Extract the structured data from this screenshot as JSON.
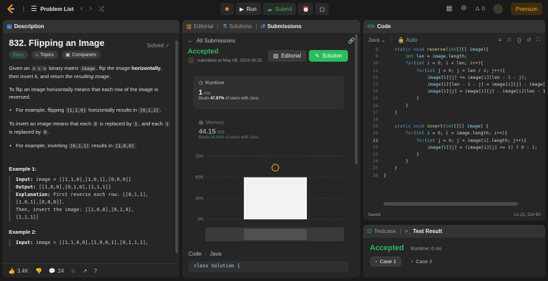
{
  "topbar": {
    "problem_list": "Problem List",
    "run": "Run",
    "submit": "Submit",
    "streak": "0",
    "premium": "Premium"
  },
  "description": {
    "tab_label": "Description",
    "title": "832. Flipping an Image",
    "solved": "Solved",
    "chips": [
      "Easy",
      "Topics",
      "Companies"
    ],
    "intro_1": "Given an",
    "intro_code_1": "n x n",
    "intro_2": "binary matrix",
    "intro_code_2": "image",
    "intro_3": ", flip the image",
    "intro_bold": "horizontally",
    "intro_4": ", then invert it, and return",
    "intro_italic": "the resulting image",
    "intro_5": ".",
    "flip_text": "To flip an image horizontally means that each row of the image is reversed.",
    "flip_bullet_1": "For example, flipping",
    "flip_bullet_code_1": "[1,1,0]",
    "flip_bullet_2": "horizontally results in",
    "flip_bullet_code_2": "[0,1,1]",
    "flip_bullet_3": ".",
    "invert_1": "To invert an image means that each",
    "invert_code_1": "0",
    "invert_2": "is replaced by",
    "invert_code_2": "1",
    "invert_3": ", and each",
    "invert_code_3": "1",
    "invert_4": "is replaced by",
    "invert_code_4": "0",
    "invert_5": ".",
    "invert_bullet_1": "For example, inverting",
    "invert_bullet_code_1": "[0,1,1]",
    "invert_bullet_2": "results in",
    "invert_bullet_code_2": "[1,0,0]",
    "invert_bullet_3": ".",
    "example1_title": "Example 1:",
    "example1_input_lbl": "Input:",
    "example1_input": " image = [[1,1,0],[1,0,1],[0,0,0]]",
    "example1_output_lbl": "Output:",
    "example1_output": " [[1,0,0],[0,1,0],[1,1,1]]",
    "example1_expl_lbl": "Explanation:",
    "example1_expl_1": " First reverse each row: [[0,1,1],",
    "example1_expl_2": "[1,0,1],[0,0,0]].",
    "example1_expl_3": "Then, invert the image: [[1,0,0],[0,1,0],",
    "example1_expl_4": "[1,1,1]]",
    "example2_title": "Example 2:",
    "example2_input_lbl": "Input:",
    "example2_input": " image = [[1,1,0,0],[1,0,0,1],[0,1,1,1],",
    "likes": "3.4K",
    "comments": "24"
  },
  "submissions": {
    "tabs": [
      "Editorial",
      "Solutions",
      "Submissions"
    ],
    "back_label": "All Submissions",
    "status": "Accepted",
    "submitted": "submitted at May 06, 2024 08:31",
    "editorial_btn": "Editorial",
    "solution_btn": "Solution",
    "runtime_label": "Runtime",
    "runtime_value": "1",
    "runtime_unit": "ms",
    "runtime_beats_1": "Beats",
    "runtime_beats_pct": "47.87%",
    "runtime_beats_2": "of users with Java",
    "memory_label": "Memory",
    "memory_value": "44.15",
    "memory_unit": "MB",
    "memory_beats_1": "Beats",
    "memory_beats_pct": "39.84%",
    "memory_beats_2": "of users with Java",
    "code_label": "Code",
    "code_lang": "Java",
    "code_preview": "class Solution {"
  },
  "chart_data": {
    "type": "bar",
    "ytick_labels": [
      "75%",
      "50%",
      "25%",
      "0%"
    ],
    "ylim": [
      0,
      75
    ],
    "values": [
      50
    ],
    "grid": true
  },
  "editor": {
    "tab_label": "Code",
    "lang": "Java",
    "auto": "Auto",
    "lines": [
      {
        "n": "8",
        "indent": 1,
        "tokens": [
          [
            "kw",
            "static "
          ],
          [
            "kw",
            "void "
          ],
          [
            "fn",
            "reverse"
          ],
          [
            "",
            "("
          ],
          [
            "ty",
            "int"
          ],
          [
            "",
            "[][] "
          ],
          [
            "va",
            "image"
          ],
          [
            "",
            "){"
          ]
        ]
      },
      {
        "n": "9",
        "indent": 2,
        "tokens": [
          [
            "ty",
            "int "
          ],
          [
            "va",
            "len"
          ],
          [
            "",
            " = "
          ],
          [
            "va",
            "image"
          ],
          [
            "",
            ".length;"
          ]
        ]
      },
      {
        "n": "10",
        "indent": 2,
        "tokens": [
          [
            "kw",
            "for"
          ],
          [
            "",
            "("
          ],
          [
            "ty",
            "int "
          ],
          [
            "va",
            "i"
          ],
          [
            "",
            " = "
          ],
          [
            "nu",
            "0"
          ],
          [
            "",
            "; i < len; i++){"
          ]
        ]
      },
      {
        "n": "11",
        "indent": 3,
        "tokens": [
          [
            "kw",
            "for"
          ],
          [
            "",
            "("
          ],
          [
            "ty",
            "int "
          ],
          [
            "va",
            "j"
          ],
          [
            "",
            " = "
          ],
          [
            "nu",
            "0"
          ],
          [
            "",
            "; j < len / "
          ],
          [
            "nu",
            "2"
          ],
          [
            "",
            "; j++){"
          ]
        ]
      },
      {
        "n": "12",
        "indent": 4,
        "tokens": [
          [
            "va",
            "image"
          ],
          [
            "",
            "[i][j] += image[i][len - "
          ],
          [
            "nu",
            "1"
          ],
          [
            "",
            " - j];"
          ]
        ]
      },
      {
        "n": "13",
        "indent": 4,
        "tokens": [
          [
            "va",
            "image"
          ],
          [
            "",
            "[i][len - "
          ],
          [
            "nu",
            "1"
          ],
          [
            "",
            " - j] = image[i][j] - image[i]"
          ]
        ]
      },
      {
        "n": "14",
        "indent": 4,
        "tokens": [
          [
            "va",
            "image"
          ],
          [
            "",
            "[i][j] = image[i][j] - image[i][len - 1"
          ]
        ]
      },
      {
        "n": "15",
        "indent": 3,
        "tokens": [
          [
            "",
            "}"
          ]
        ]
      },
      {
        "n": "16",
        "indent": 2,
        "tokens": [
          [
            "",
            "}"
          ]
        ]
      },
      {
        "n": "17",
        "indent": 1,
        "tokens": [
          [
            "",
            "}"
          ]
        ]
      },
      {
        "n": "18",
        "indent": 0,
        "tokens": []
      },
      {
        "n": "19",
        "indent": 1,
        "tokens": [
          [
            "kw",
            "static "
          ],
          [
            "kw",
            "void "
          ],
          [
            "fn",
            "invert"
          ],
          [
            "",
            "("
          ],
          [
            "ty",
            "int"
          ],
          [
            "",
            "[][] "
          ],
          [
            "va",
            "image"
          ],
          [
            "",
            ") {"
          ]
        ]
      },
      {
        "n": "20",
        "indent": 2,
        "tokens": [
          [
            "kw",
            "for"
          ],
          [
            "",
            "("
          ],
          [
            "ty",
            "int "
          ],
          [
            "va",
            "i"
          ],
          [
            "",
            " = "
          ],
          [
            "nu",
            "0"
          ],
          [
            "",
            "; i < image.length; i++){"
          ]
        ]
      },
      {
        "n": "21",
        "indent": 3,
        "tokens": [
          [
            "kw",
            "for"
          ],
          [
            "",
            "("
          ],
          [
            "ty",
            "int "
          ],
          [
            "va",
            "j"
          ],
          [
            "",
            " = "
          ],
          [
            "nu",
            "0"
          ],
          [
            "",
            "; j < image[i].length; j++){"
          ]
        ]
      },
      {
        "n": "22",
        "indent": 4,
        "tokens": [
          [
            "va",
            "image"
          ],
          [
            "",
            "[i][j] = (image[i][j] == "
          ],
          [
            "nu",
            "1"
          ],
          [
            "",
            ") ? "
          ],
          [
            "nu",
            "0"
          ],
          [
            "",
            " : "
          ],
          [
            "nu",
            "1"
          ],
          [
            "",
            ";"
          ]
        ]
      },
      {
        "n": "23",
        "indent": 3,
        "tokens": [
          [
            "",
            "}"
          ]
        ]
      },
      {
        "n": "24",
        "indent": 2,
        "tokens": [
          [
            "",
            "}"
          ]
        ]
      },
      {
        "n": "25",
        "indent": 1,
        "tokens": [
          [
            "",
            "}"
          ]
        ]
      },
      {
        "n": "26",
        "indent": 0,
        "tokens": [
          [
            "",
            "}"
          ]
        ]
      }
    ],
    "saved": "Saved",
    "position": "Ln 21, Col 50"
  },
  "test": {
    "tab_testcase": "Testcase",
    "tab_result": "Test Result",
    "status": "Accepted",
    "runtime": "Runtime: 0 ms",
    "cases": [
      "Case 1",
      "Case 2"
    ]
  },
  "colors": {
    "accent_green": "#2cbb5d",
    "premium": "#ffa116",
    "easy": "#00b8a3"
  }
}
